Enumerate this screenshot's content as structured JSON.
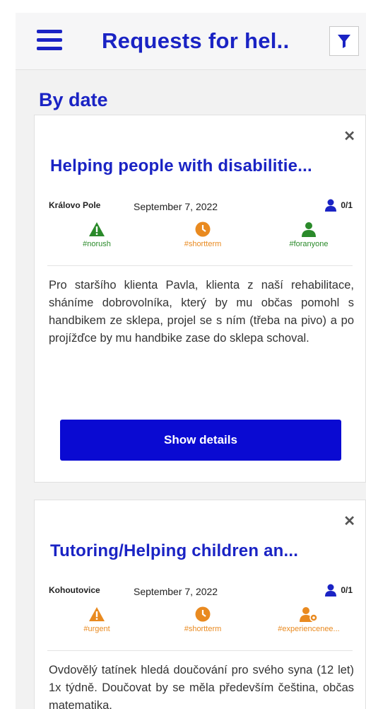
{
  "header": {
    "title": "Requests for hel..",
    "menu_icon": "hamburger-menu-icon",
    "filter_icon": "filter-icon"
  },
  "section": {
    "title": "By date"
  },
  "colors": {
    "accent": "#1a23c4",
    "button": "#0a0ad2",
    "green": "#2a8a2a",
    "orange": "#e98a20"
  },
  "cards": [
    {
      "title": "Helping people with disabilitie...",
      "location": "Královo Pole",
      "date": "September 7, 2022",
      "capacity": "0/1",
      "tags": [
        {
          "label": "#norush",
          "icon": "warning-icon",
          "color": "green"
        },
        {
          "label": "#shortterm",
          "icon": "clock-icon",
          "color": "orange"
        },
        {
          "label": "#foranyone",
          "icon": "person-icon",
          "color": "green"
        }
      ],
      "description": "Pro staršího klienta Pavla, klienta z naší rehabilitace, sháníme dobrovolníka, který by mu občas pomohl s handbikem ze sklepa, projel se s ním (třeba na pivo) a po projížďce by mu handbike zase do sklepa schoval.",
      "button": "Show details"
    },
    {
      "title": "Tutoring/Helping children an...",
      "location": "Kohoutovice",
      "date": "September 7, 2022",
      "capacity": "0/1",
      "tags": [
        {
          "label": "#urgent",
          "icon": "warning-icon",
          "color": "orange"
        },
        {
          "label": "#shortterm",
          "icon": "clock-icon",
          "color": "orange"
        },
        {
          "label": "#experiencenee...",
          "icon": "person-skill-icon",
          "color": "orange"
        }
      ],
      "description": "Ovdovělý tatínek hledá doučování pro svého syna (12 let) 1x týdně. Doučovat by se měla především čeština, občas matematika."
    }
  ]
}
